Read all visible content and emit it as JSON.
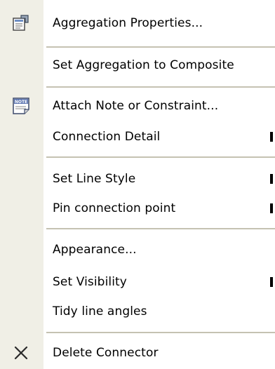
{
  "menu": {
    "items": [
      {
        "label": "Aggregation Properties...",
        "icon": "aggregation-properties-icon"
      },
      {
        "label": "Set Aggregation to Composite"
      },
      {
        "label": "Attach Note or Constraint...",
        "icon": "note-icon"
      },
      {
        "label": "Connection Detail",
        "submenu": true
      },
      {
        "label": "Set Line Style",
        "submenu": true
      },
      {
        "label": "Pin connection point",
        "submenu": true
      },
      {
        "label": "Appearance..."
      },
      {
        "label": "Set Visibility",
        "submenu": true
      },
      {
        "label": "Tidy line angles"
      },
      {
        "label": "Delete Connector",
        "icon": "delete-x-icon"
      }
    ]
  },
  "colors": {
    "gutter": "#f0efe6",
    "separator": "#c5c2b2",
    "text": "#000000"
  }
}
